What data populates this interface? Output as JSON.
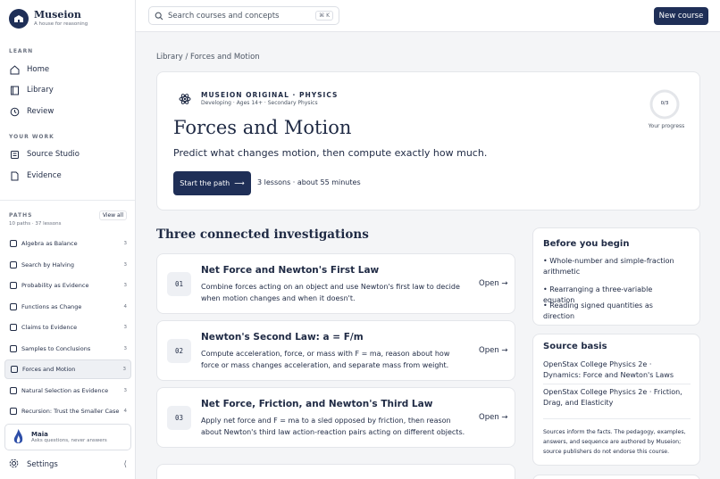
{
  "brand": {
    "name": "Museion",
    "tagline": "A house for reasoning"
  },
  "nav": {
    "learn_label": "LEARN",
    "learn_items": [
      "Home",
      "Library",
      "Review"
    ],
    "work_label": "YOUR WORK",
    "work_items": [
      "Source Studio",
      "Evidence"
    ]
  },
  "paths": {
    "label": "PATHS",
    "view_all": "View all",
    "count": "10 paths · 37 lessons",
    "items": [
      {
        "label": "Algebra as Balance",
        "count": "3"
      },
      {
        "label": "Search by Halving",
        "count": "3"
      },
      {
        "label": "Probability as Evidence",
        "count": "3"
      },
      {
        "label": "Functions as Change",
        "count": "4"
      },
      {
        "label": "Claims to Evidence",
        "count": "3"
      },
      {
        "label": "Samples to Conclusions",
        "count": "3"
      },
      {
        "label": "Forces and Motion",
        "count": "3"
      },
      {
        "label": "Natural Selection as Evidence",
        "count": "3"
      },
      {
        "label": "Recursion: Trust the Smaller Case",
        "count": "4"
      }
    ]
  },
  "maia": {
    "name": "Maia",
    "desc": "Asks questions, never answers"
  },
  "settings_label": "Settings",
  "search": {
    "placeholder": "Search courses and concepts",
    "shortcut": "⌘ K"
  },
  "new_course_label": "New course",
  "breadcrumb": {
    "root": "Library",
    "sep": "/",
    "current": "Forces and Motion"
  },
  "hero": {
    "org": "MUSEION ORIGINAL · PHYSICS",
    "meta": "Developing · Ages 14+ · Secondary Physics",
    "title": "Forces and Motion",
    "description": "Predict what changes motion, then compute exactly how much.",
    "start_label": "Start the path",
    "stats": "3 lessons · about 55 minutes",
    "progress_text": "0/3",
    "progress_fraction": 0,
    "progress_label": "Your progress"
  },
  "section_title": "Three connected investigations",
  "lessons": [
    {
      "number": "01",
      "title": "Net Force and Newton's First Law",
      "description": "Combine forces acting on an object and use Newton's first law to decide when motion changes and when it doesn't.",
      "open_label": "Open →"
    },
    {
      "number": "02",
      "title": "Newton's Second Law: a = F/m",
      "description": "Compute acceleration, force, or mass with F = ma, reason about how force or mass changes acceleration, and separate mass from weight.",
      "open_label": "Open →"
    },
    {
      "number": "03",
      "title": "Net Force, Friction, and Newton's Third Law",
      "description": "Apply net force and F = ma to a sled opposed by friction, then reason about Newton's third law action-reaction pairs acting on different objects.",
      "open_label": "Open →"
    }
  ],
  "before": {
    "title": "Before you begin",
    "items": [
      "• Whole-number and simple-fraction arithmetic",
      "• Rearranging a three-variable equation",
      "• Reading signed quantities as direction"
    ]
  },
  "sources": {
    "title": "Source basis",
    "items": [
      "OpenStax College Physics 2e · Dynamics: Force and Newton's Laws",
      "OpenStax College Physics 2e · Friction, Drag, and Elasticity"
    ],
    "note": "Sources inform the facts. The pedagogy, examples, answers, and sequence are authored by Museion; source publishers do not endorse this course."
  },
  "colors": {
    "primary": "#1f2f57",
    "background": "#f4f5f7"
  }
}
